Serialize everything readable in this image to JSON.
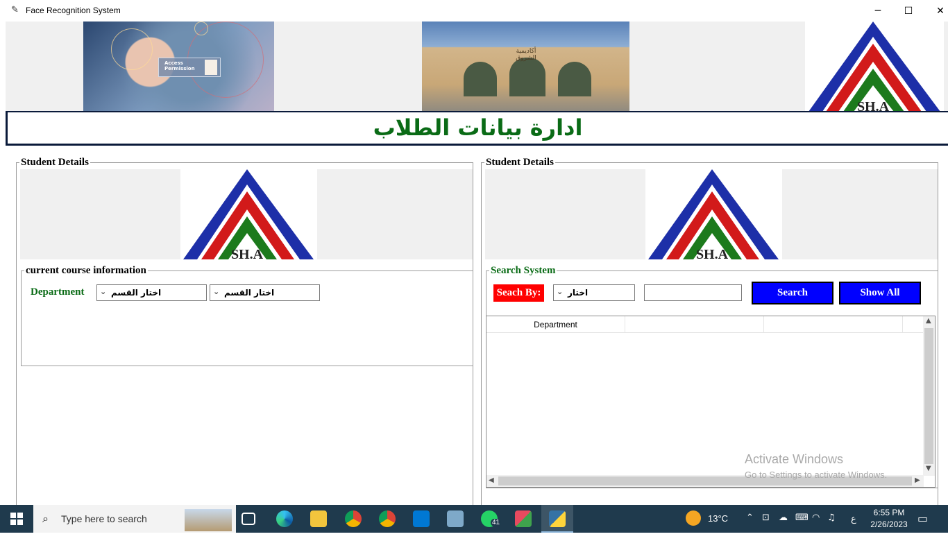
{
  "window": {
    "title": "Face Recognition System",
    "app_icon": "feather-icon",
    "controls": {
      "minimize": "─",
      "maximize": "☐",
      "close": "✕"
    }
  },
  "banner": {
    "face_card_text": "Access\nPermission",
    "campus_sign": "أكاديمية الشروق",
    "logo_text": "SH.A"
  },
  "heading": "ادارة بيانات الطلاب",
  "left_panel": {
    "legend": "Student Details",
    "logo_text": "SH.A",
    "course_frame": {
      "legend": "current course information",
      "department_label": "Department",
      "combo1": "اختار القسم",
      "combo2": "اختار القسم"
    }
  },
  "right_panel": {
    "legend": "Student Details",
    "logo_text": "SH.A",
    "search_frame": {
      "legend": "Search System",
      "search_by_label": "Seach By:",
      "search_by_value": "اختار",
      "search_text": "",
      "search_button": "Search",
      "show_all_button": "Show All"
    },
    "table": {
      "columns": [
        "Department",
        "",
        ""
      ]
    }
  },
  "watermark": {
    "line1": "Activate Windows",
    "line2": "Go to Settings to activate Windows."
  },
  "taskbar": {
    "search_placeholder": "Type here to search",
    "weather": "13°C",
    "language": "ع",
    "time": "6:55 PM",
    "date": "2/26/2023",
    "whatsapp_badge": "41"
  },
  "colors": {
    "heading_green": "#0a6b16",
    "button_blue": "#0000ff",
    "search_by_red": "#ff0000",
    "taskbar": "#1f3a4d"
  }
}
